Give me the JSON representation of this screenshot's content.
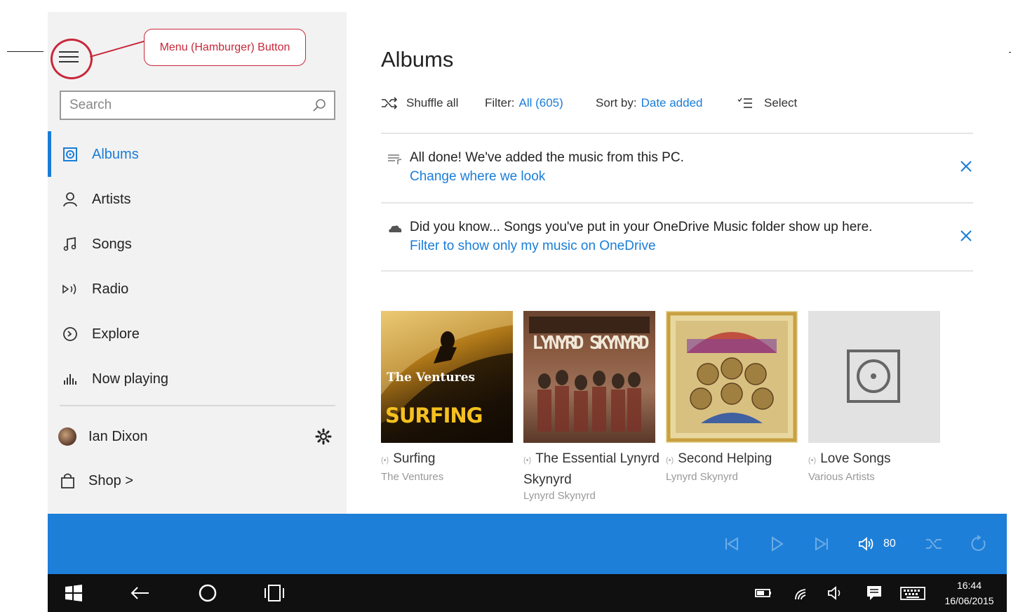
{
  "annotation": {
    "label": "Menu (Hamburger) Button"
  },
  "sidebar": {
    "search_placeholder": "Search",
    "nav": [
      {
        "label": "Albums",
        "icon": "album-icon",
        "active": true
      },
      {
        "label": "Artists",
        "icon": "person-icon"
      },
      {
        "label": "Songs",
        "icon": "music-note-icon"
      },
      {
        "label": "Radio",
        "icon": "radio-icon"
      },
      {
        "label": "Explore",
        "icon": "compass-icon"
      },
      {
        "label": "Now playing",
        "icon": "bars-icon"
      }
    ],
    "user_name": "Ian Dixon",
    "shop_label": "Shop >"
  },
  "main": {
    "title": "Albums",
    "toolbar": {
      "shuffle_label": "Shuffle all",
      "filter_label": "Filter:",
      "filter_value": "All (605)",
      "sort_label": "Sort by:",
      "sort_value": "Date added",
      "select_label": "Select"
    },
    "notices": [
      {
        "text": "All done! We've added the music from this PC.",
        "link": "Change where we look"
      },
      {
        "text": "Did you know... Songs you've put in your OneDrive Music folder show up here.",
        "link": "Filter to show only my music on OneDrive"
      }
    ],
    "albums": [
      {
        "title": "Surfing",
        "artist": "The Ventures",
        "art_text": "SURFING",
        "art_sub": "The Ventures"
      },
      {
        "title": "The Essential Lynyrd Skynyrd",
        "artist": "Lynyrd Skynyrd",
        "art_text": "LYNYRD SKYNYRD"
      },
      {
        "title": "Second Helping",
        "artist": "Lynyrd Skynyrd"
      },
      {
        "title": "Love Songs",
        "artist": "Various Artists"
      }
    ]
  },
  "player": {
    "volume": "80"
  },
  "taskbar": {
    "time": "16:44",
    "date": "16/06/2015"
  },
  "colors": {
    "accent": "#1a7dd8",
    "player_bar": "#1e7fd8",
    "taskbar": "#101010",
    "annotation": "#c8283a"
  }
}
